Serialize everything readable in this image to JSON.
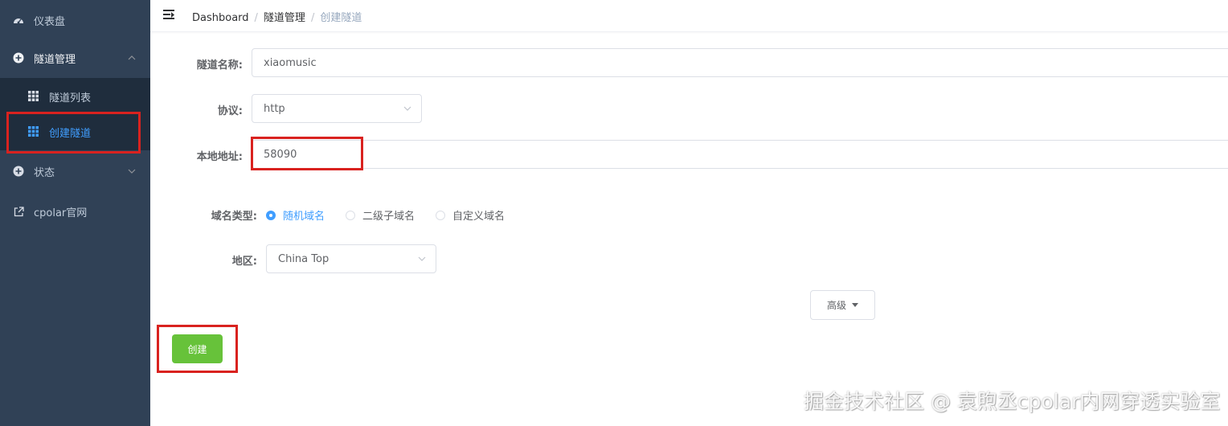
{
  "sidebar": {
    "items": [
      {
        "label": "仪表盘",
        "icon": "dashboard-icon"
      },
      {
        "label": "隧道管理",
        "icon": "plus-circle-icon",
        "expanded": true
      },
      {
        "label": "状态",
        "icon": "plus-circle-icon"
      },
      {
        "label": "cpolar官网",
        "icon": "external-link-icon"
      }
    ],
    "sub_items": [
      {
        "label": "隧道列表",
        "icon": "grid-icon"
      },
      {
        "label": "创建隧道",
        "icon": "grid-icon",
        "active": true
      }
    ]
  },
  "breadcrumb": {
    "items": [
      "Dashboard",
      "隧道管理",
      "创建隧道"
    ]
  },
  "form": {
    "name_label": "隧道名称:",
    "name_value": "xiaomusic",
    "protocol_label": "协议:",
    "protocol_value": "http",
    "local_addr_label": "本地地址:",
    "local_addr_value": "58090",
    "domain_type_label": "域名类型:",
    "domain_options": [
      "随机域名",
      "二级子域名",
      "自定义域名"
    ],
    "domain_selected": "随机域名",
    "region_label": "地区:",
    "region_value": "China Top",
    "advanced_label": "高级",
    "create_label": "创建"
  },
  "watermark": "掘金技术社区 @ 袁煦丞cpolar内网穿透实验室",
  "colors": {
    "sidebar_bg": "#304156",
    "submenu_bg": "#1f2d3d",
    "active": "#409eff",
    "create_button": "#67c23a",
    "highlight_box": "#d9221f"
  }
}
